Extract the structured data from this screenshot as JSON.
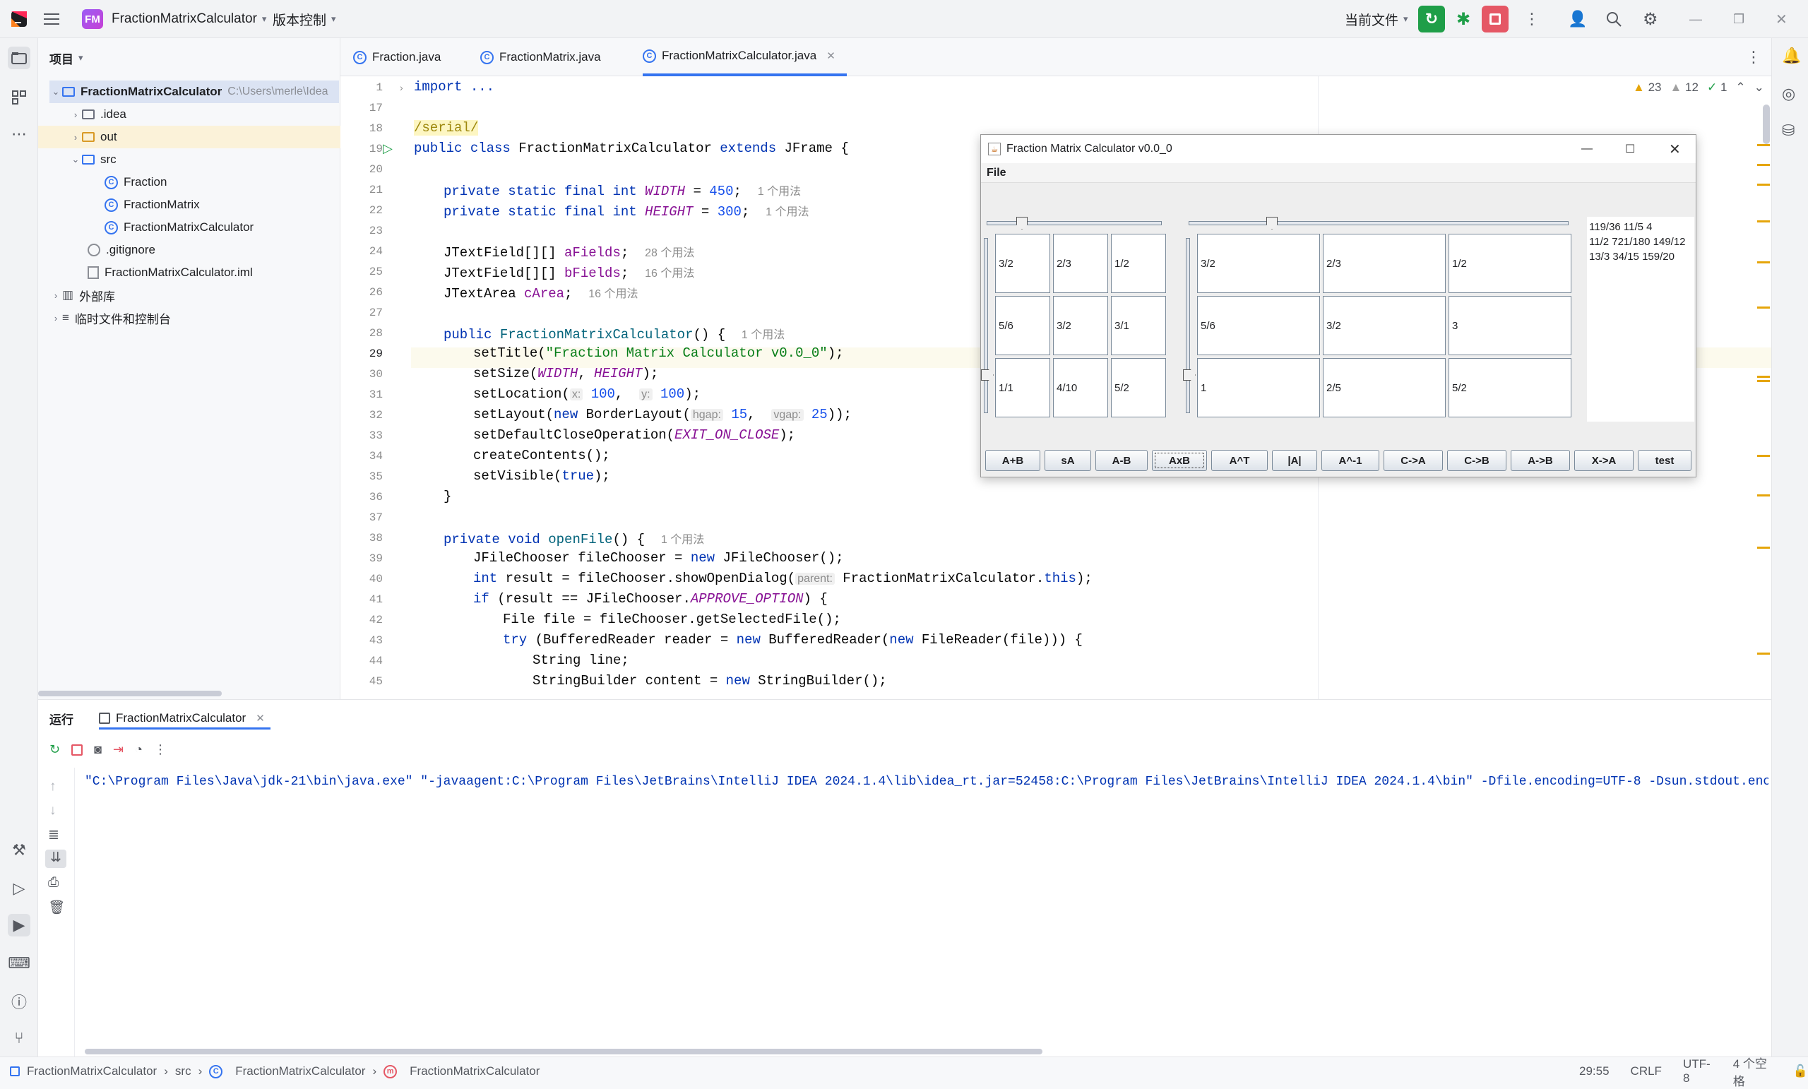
{
  "titlebar": {
    "project_badge": "FM",
    "project_name": "FractionMatrixCalculator",
    "vcs": "版本控制",
    "run_config": "当前文件"
  },
  "project_panel": {
    "header": "项目",
    "root_name": "FractionMatrixCalculator",
    "root_path": "C:\\Users\\merle\\Idea",
    "items": [
      ".idea",
      "out",
      "src",
      "Fraction",
      "FractionMatrix",
      "FractionMatrixCalculator",
      ".gitignore",
      "FractionMatrixCalculator.iml",
      "外部库",
      "临时文件和控制台"
    ]
  },
  "tabs": [
    "Fraction.java",
    "FractionMatrix.java",
    "FractionMatrixCalculator.java"
  ],
  "inspections": {
    "warnings": "23",
    "weak": "12",
    "ok": "1"
  },
  "editor": {
    "line_numbers": [
      "1",
      "17",
      "18",
      "19",
      "20",
      "21",
      "22",
      "23",
      "24",
      "25",
      "26",
      "27",
      "28",
      "29",
      "30",
      "31",
      "32",
      "33",
      "34",
      "35",
      "36",
      "37",
      "38",
      "39",
      "40",
      "41",
      "42",
      "43",
      "44",
      "45"
    ],
    "lines": {
      "l1": "import ...",
      "l18": "/serial/",
      "l19a": "public class ",
      "l19b": "FractionMatrixCalculator ",
      "l19c": "extends ",
      "l19d": "JFrame {",
      "l21a": "private static final int ",
      "l21b": "WIDTH",
      "l21c": " = ",
      "l21d": "450",
      "l21e": ";",
      "l21h": "1 个用法",
      "l22a": "private static final int ",
      "l22b": "HEIGHT",
      "l22c": " = ",
      "l22d": "300",
      "l22e": ";",
      "l22h": "1 个用法",
      "l24a": "JTextField[][] ",
      "l24b": "aFields",
      "l24c": ";",
      "l24h": "28 个用法",
      "l25a": "JTextField[][] ",
      "l25b": "bFields",
      "l25c": ";",
      "l25h": "16 个用法",
      "l26a": "JTextArea ",
      "l26b": "cArea",
      "l26c": ";",
      "l26h": "16 个用法",
      "l28a": "public ",
      "l28b": "FractionMatrixCalculator",
      "l28c": "() {",
      "l28h": "1 个用法",
      "l29a": "setTitle(",
      "l29b": "\"Fraction Matrix Calculator v0.0_0\"",
      "l29c": ");",
      "l30a": "setSize(",
      "l30b": "WIDTH",
      "l30c": ", ",
      "l30d": "HEIGHT",
      "l30e": ");",
      "l31a": "setLocation(",
      "l31x": "x:",
      "l31b": "100",
      "l31c": ",  ",
      "l31y": "y:",
      "l31d": "100",
      "l31e": ");",
      "l32a": "setLayout(",
      "l32b": "new ",
      "l32c": "BorderLayout(",
      "l32h1": "hgap:",
      "l32d": "15",
      "l32e": ",  ",
      "l32h2": "vgap:",
      "l32f": "25",
      "l32g": "));",
      "l33a": "setDefaultCloseOperation(",
      "l33b": "EXIT_ON_CLOSE",
      "l33c": ");",
      "l34": "createContents();",
      "l35a": "setVisible(",
      "l35b": "true",
      "l35c": ");",
      "l36": "}",
      "l38a": "private void ",
      "l38b": "openFile",
      "l38c": "() {",
      "l38h": "1 个用法",
      "l39a": "JFileChooser fileChooser = ",
      "l39b": "new ",
      "l39c": "JFileChooser();",
      "l40a": "int ",
      "l40b": "result = fileChooser.showOpenDialog(",
      "l40h": "parent:",
      "l40c": " FractionMatrixCalculator.",
      "l40d": "this",
      "l40e": ");",
      "l41a": "if ",
      "l41b": "(result == JFileChooser.",
      "l41c": "APPROVE_OPTION",
      "l41d": ") {",
      "l42": "File file = fileChooser.getSelectedFile();",
      "l43a": "try ",
      "l43b": "(BufferedReader reader = ",
      "l43c": "new ",
      "l43d": "BufferedReader(",
      "l43e": "new ",
      "l43f": "FileReader(file))) {",
      "l44": "String line;",
      "l45a": "StringBuilder content = ",
      "l45b": "new ",
      "l45c": "StringBuilder();"
    }
  },
  "swing": {
    "title": "Fraction Matrix Calculator v0.0_0",
    "menu": "File",
    "a_matrix": [
      [
        "3/2",
        "2/3",
        "1/2"
      ],
      [
        "5/6",
        "3/2",
        "3/1"
      ],
      [
        "1/1",
        "4/10",
        "5/2"
      ]
    ],
    "b_matrix": [
      [
        "3/2",
        "2/3",
        "1/2"
      ],
      [
        "5/6",
        "3/2",
        "3"
      ],
      [
        "1",
        "2/5",
        "5/2"
      ]
    ],
    "c_area": [
      "119/36 11/5 4",
      "11/2 721/180 149/12",
      "13/3 34/15 159/20"
    ],
    "buttons": [
      "A+B",
      "sA",
      "A-B",
      "AxB",
      "A^T",
      "|A|",
      "A^-1",
      "C->A",
      "C->B",
      "A->B",
      "X->A",
      "test"
    ]
  },
  "run_panel": {
    "label": "运行",
    "tab": "FractionMatrixCalculator",
    "console_line": "\"C:\\Program Files\\Java\\jdk-21\\bin\\java.exe\" \"-javaagent:C:\\Program Files\\JetBrains\\IntelliJ IDEA 2024.1.4\\lib\\idea_rt.jar=52458:C:\\Program Files\\JetBrains\\IntelliJ IDEA 2024.1.4\\bin\" -Dfile.encoding=UTF-8 -Dsun.stdout.encodi"
  },
  "statusbar": {
    "crumbs": [
      "FractionMatrixCalculator",
      "src",
      "FractionMatrixCalculator",
      "FractionMatrixCalculator"
    ],
    "position": "29:55",
    "line_sep": "CRLF",
    "encoding": "UTF-8",
    "indent": "4 个空格"
  }
}
